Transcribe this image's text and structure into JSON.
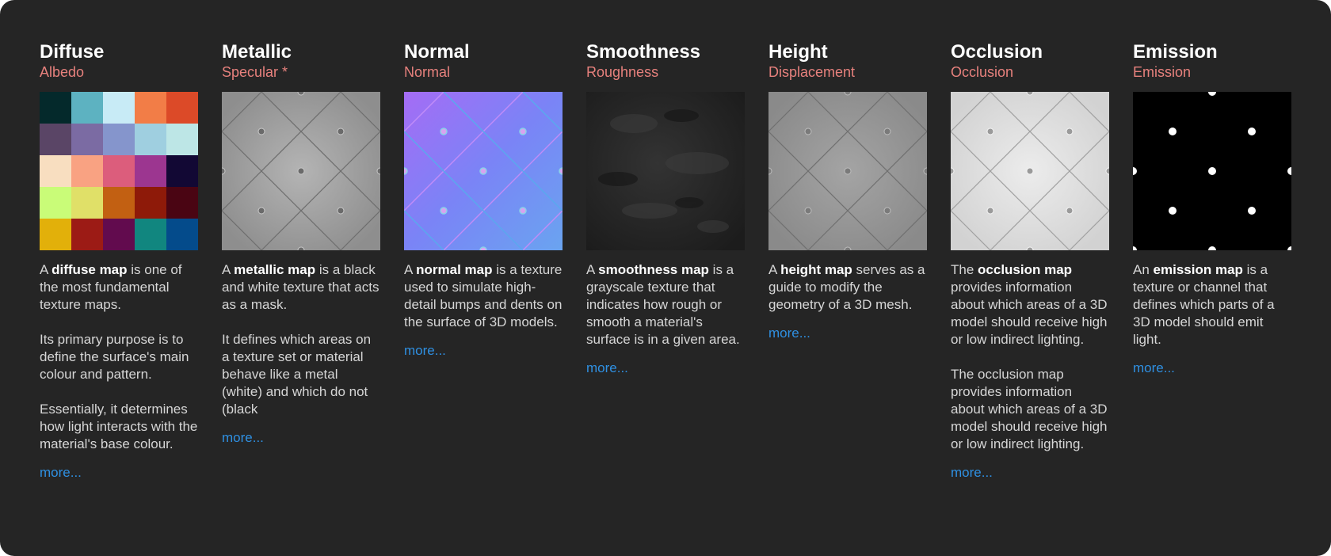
{
  "colors": {
    "panel_bg": "#252525",
    "title": "#ffffff",
    "subtitle": "#e7817d",
    "body_text": "#d6d6d6",
    "link": "#2f90e2"
  },
  "more_label": "more...",
  "maps": [
    {
      "title": "Diffuse",
      "subtitle": "Albedo",
      "p1_pre": "A ",
      "p1_bold": "diffuse map",
      "p1_post": " is one of the most fundamental texture maps.",
      "p2": "Its primary purpose is to define the surface's main colour and pattern.",
      "p3": "Essentially, it determines how light interacts with the material's base colour.",
      "swatches": [
        "#04292b",
        "#5db2c1",
        "#c8ebf6",
        "#f27d47",
        "#dc4a28",
        "#5a4566",
        "#7b6ba3",
        "#8595cc",
        "#9fcfe0",
        "#bde6e6",
        "#f8dec0",
        "#f9a282",
        "#dc5d7c",
        "#9c3690",
        "#120834",
        "#c9fc78",
        "#e0e068",
        "#c26012",
        "#8e1a09",
        "#4a0513",
        "#e2b00a",
        "#9c1b15",
        "#620b4e",
        "#11867f",
        "#044b8b"
      ]
    },
    {
      "title": "Metallic",
      "subtitle": "Specular *",
      "p1_pre": "A ",
      "p1_bold": "metallic map",
      "p1_post": " is a black and white texture that acts as a mask.",
      "p2": "It defines which areas on a texture set or material behave like a metal (white) and which do not (black"
    },
    {
      "title": "Normal",
      "subtitle": "Normal",
      "p1_pre": "A ",
      "p1_bold": "normal map",
      "p1_post": " is a texture used to simulate high-detail bumps and dents on the surface of 3D models."
    },
    {
      "title": "Smoothness",
      "subtitle": "Roughness",
      "p1_pre": "A ",
      "p1_bold": "smoothness map",
      "p1_post": " is a grayscale texture that indicates how rough or smooth a material's surface is in a given area."
    },
    {
      "title": "Height",
      "subtitle": "Displacement",
      "p1_pre": "A ",
      "p1_bold": "height map",
      "p1_post": " serves as a guide to modify the geometry of a 3D mesh."
    },
    {
      "title": "Occlusion",
      "subtitle": "Occlusion",
      "p1_pre": "The ",
      "p1_bold": "occlusion map",
      "p1_post": " provides information about which areas of a 3D model should receive high or low indirect lighting.",
      "p2": "The occlusion map provides information about which areas of a 3D model should receive high or low indirect lighting."
    },
    {
      "title": "Emission",
      "subtitle": "Emission",
      "p1_pre": "An ",
      "p1_bold": "emission map",
      "p1_post": " is a texture or channel that defines which parts of a 3D model should emit light."
    }
  ]
}
